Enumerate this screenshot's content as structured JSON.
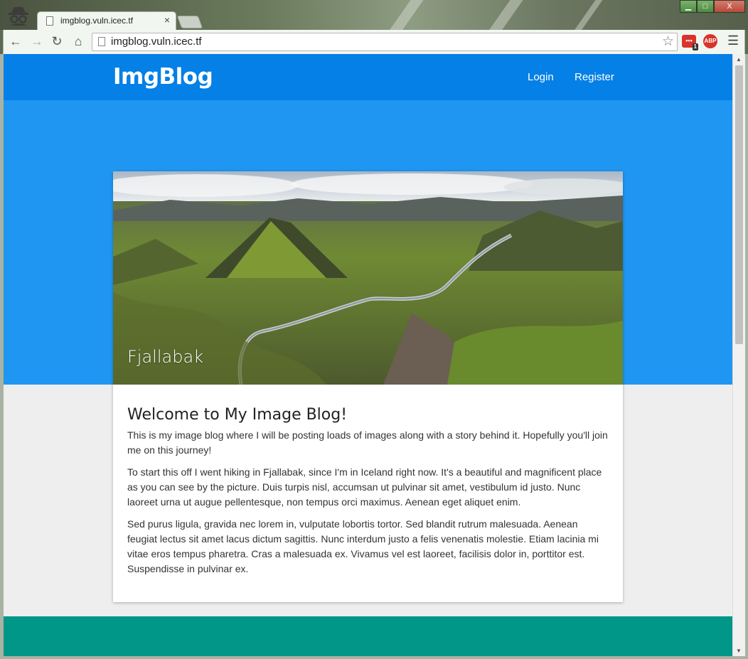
{
  "browser": {
    "tab_title": "imgblog.vuln.icec.tf",
    "tab_close": "×",
    "url": "imgblog.vuln.icec.tf",
    "ext_badge_count": "1",
    "ext_adblock_label": "ABP",
    "window_buttons": [
      "▁",
      "□",
      "X"
    ]
  },
  "site": {
    "brand": "ImgBlog",
    "nav": [
      "Login",
      "Register"
    ]
  },
  "post": {
    "image_title": "Fjallabak",
    "heading": "Welcome to My Image Blog!",
    "paragraphs": [
      "This is my image blog where I will be posting loads of images along with a story behind it. Hopefully you'll join me on this journey!",
      "To start this off I went hiking in Fjallabak, since I'm in Iceland right now. It's a beautiful and magnificent place as you can see by the picture. Duis turpis nisl, accumsan ut pulvinar sit amet, vestibulum id justo. Nunc laoreet urna ut augue pellentesque, non tempus orci maximus. Aenean eget aliquet enim.",
      "Sed purus ligula, gravida nec lorem in, vulputate lobortis tortor. Sed blandit rutrum malesuada. Aenean feugiat lectus sit amet lacus dictum sagittis. Nunc interdum justo a felis venenatis molestie. Etiam lacinia mi vitae eros tempus pharetra. Cras a malesuada ex. Vivamus vel est laoreet, facilisis dolor in, porttitor est. Suspendisse in pulvinar ex."
    ]
  },
  "colors": {
    "navbar": "#0480e6",
    "hero": "#1f96f2",
    "page_bg": "#eeeeee",
    "footer": "#009688"
  }
}
